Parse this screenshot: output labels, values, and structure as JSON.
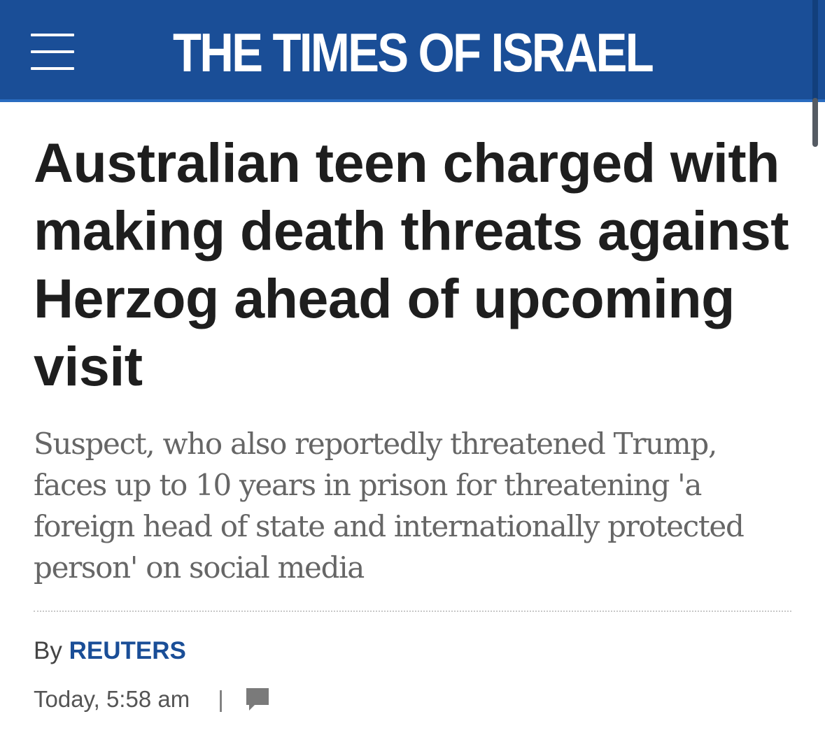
{
  "header": {
    "site_name": "THE TIMES OF ISRAEL",
    "menu_icon": "hamburger-menu-icon",
    "background_color": "#1a4e97"
  },
  "article": {
    "headline": "Australian teen charged with making death threats against Herzog ahead of upcoming visit",
    "subheadline": "Suspect, who also reportedly threatened Trump, faces up to 10 years in prison for threatening 'a foreign head of state and internationally protected person' on social media",
    "byline_prefix": "By",
    "author": "REUTERS",
    "timestamp": "Today, 5:58 am",
    "separator": "|",
    "comment_icon": "comment-bubble-icon",
    "author_color": "#1a4e97"
  }
}
